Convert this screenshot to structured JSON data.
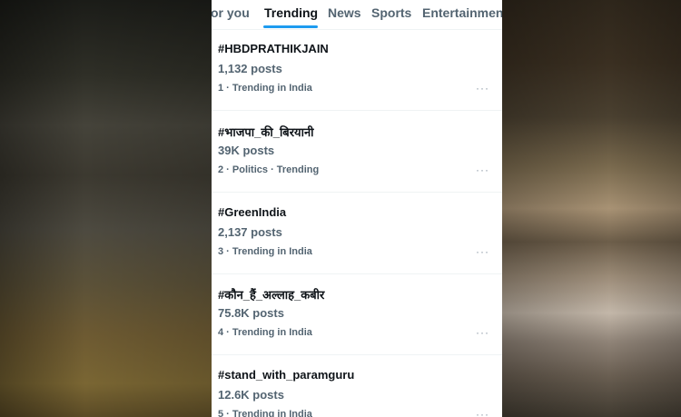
{
  "tabs": [
    {
      "label": "or you"
    },
    {
      "label": "Trending"
    },
    {
      "label": "News"
    },
    {
      "label": "Sports"
    },
    {
      "label": "Entertainment"
    }
  ],
  "active_tab": "Trending",
  "trends": [
    {
      "name": "#HBDPRATHIKJAIN",
      "posts": "1,132 posts",
      "meta": "1 · Trending in India"
    },
    {
      "name": "#भाजपा_की_बिरयानी",
      "posts": "39K posts",
      "meta": "2 · Politics · Trending"
    },
    {
      "name": "#GreenIndia",
      "posts": "2,137 posts",
      "meta": "3 · Trending in India"
    },
    {
      "name": "#कौन_हैं_अल्लाह_कबीर",
      "posts": "75.8K posts",
      "meta": "4 · Trending in India"
    },
    {
      "name": "#stand_with_paramguru",
      "posts": "12.6K posts",
      "meta": "5 · Trending in India"
    }
  ],
  "more_label": "···",
  "colors": {
    "accent": "#1d9bf0",
    "text_primary": "#0f1419",
    "text_secondary": "#536471"
  },
  "icons": {
    "more": "more-horizontal-icon"
  }
}
